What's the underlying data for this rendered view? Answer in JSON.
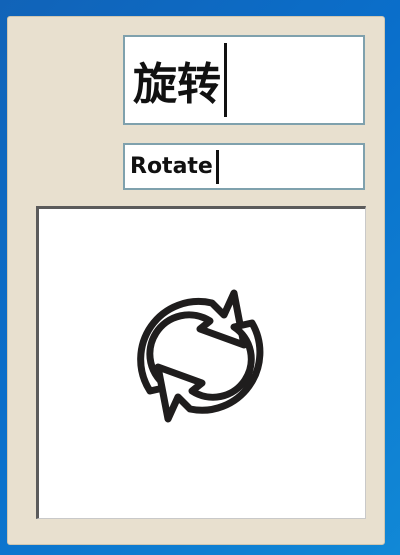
{
  "fields": {
    "chinese_value": "旋转",
    "english_value": "Rotate"
  },
  "icon": {
    "name": "rotate-icon",
    "color": "#1f1d1d"
  },
  "colors": {
    "desktop": "#0a6fcb",
    "panel": "#e8e0cf",
    "field_border": "#7fa1ad"
  }
}
